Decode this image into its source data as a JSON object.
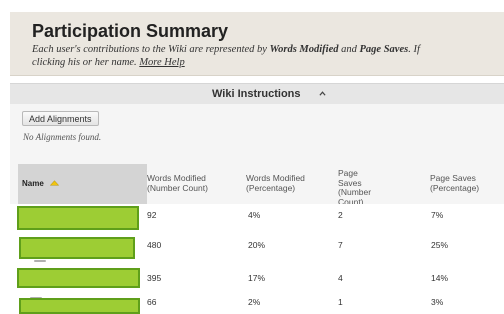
{
  "header": {
    "title": "Participation Summary",
    "desc_part1": "Each user's contributions to the Wiki are represented by ",
    "words_modified": "Words Modified",
    "and": " and ",
    "page_saves": "Page Saves",
    "desc_part2": ". If",
    "desc_line2": "clicking his or her name. ",
    "more_help": "More Help"
  },
  "instructions": {
    "label": "Wiki Instructions",
    "icon": "chevron-up-icon"
  },
  "alignments": {
    "button_label": "Add Alignments",
    "empty_text": "No Alignments found."
  },
  "table": {
    "headers": {
      "name": "Name",
      "words_count": "Words Modified (Number Count)",
      "words_pct": "Words Modified (Percentage)",
      "saves_count": "Page Saves (Number Count)",
      "saves_pct": "Page Saves (Percentage)"
    },
    "sort_icon": "sort-ascending-icon",
    "rows": [
      {
        "words_count": "92",
        "words_pct": "4%",
        "saves_count": "2",
        "saves_pct": "7%"
      },
      {
        "words_count": "480",
        "words_pct": "20%",
        "saves_count": "7",
        "saves_pct": "25%"
      },
      {
        "words_count": "395",
        "words_pct": "17%",
        "saves_count": "4",
        "saves_pct": "14%"
      },
      {
        "words_count": "66",
        "words_pct": "2%",
        "saves_count": "1",
        "saves_pct": "3%"
      }
    ]
  },
  "colors": {
    "header_bg": "#ebe7e0",
    "redaction_fill": "#9dcd34",
    "redaction_border": "#5f9f1a",
    "name_header_bg": "#d4d4d4"
  }
}
